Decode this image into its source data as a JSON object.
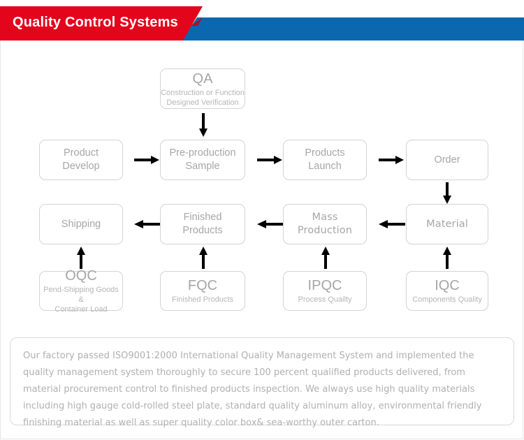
{
  "header": {
    "title": "Quality Control Systems",
    "red_color": "#e3051b",
    "blue_color": "#0b68ae",
    "text_color": "#ffffff"
  },
  "flowchart": {
    "node_border_color": "#d3d3d3",
    "node_text_color": "#a6a6a6",
    "arrow_color": "#000000",
    "nodes": [
      {
        "id": "qa",
        "title": "QA",
        "subtitle": "Construction or Function\nDesigned Verification",
        "style": "titled"
      },
      {
        "id": "product-develop",
        "title": "Product\nDevelop",
        "style": "plain"
      },
      {
        "id": "pre-production-sample",
        "title": "Pre-production\nSample",
        "style": "plain"
      },
      {
        "id": "products-launch",
        "title": "Products\nLaunch",
        "style": "plain"
      },
      {
        "id": "order",
        "title": "Order",
        "style": "plain"
      },
      {
        "id": "shipping",
        "title": "Shipping",
        "style": "plain"
      },
      {
        "id": "finished-products",
        "title": "Finished\nProducts",
        "style": "plain"
      },
      {
        "id": "mass-production",
        "title": "Mass\nProduction",
        "style": "geometric"
      },
      {
        "id": "material",
        "title": "Material",
        "style": "geometric"
      },
      {
        "id": "oqc",
        "title": "OQC",
        "subtitle": "Pend-Shipping Goods &\nContainer Load",
        "style": "titled"
      },
      {
        "id": "fqc",
        "title": "FQC",
        "subtitle": "Finished Products",
        "style": "titled"
      },
      {
        "id": "ipqc",
        "title": "IPQC",
        "subtitle": "Process Quailty",
        "style": "titled"
      },
      {
        "id": "iqc",
        "title": "IQC",
        "subtitle": "Components Quality",
        "style": "titled"
      }
    ]
  },
  "note": {
    "text": "Our factory passed ISO9001:2000 International Quality Management System and  implemented the quality management system thoroughly to secure 100 percent qualified products delivered, from material procurement control to finished products inspection. We always use high quality materials including high gauge cold-rolled steel plate, standard quality aluminum alloy, environmental friendly finishing material as well as super quality color box& sea-worthy outer carton."
  }
}
